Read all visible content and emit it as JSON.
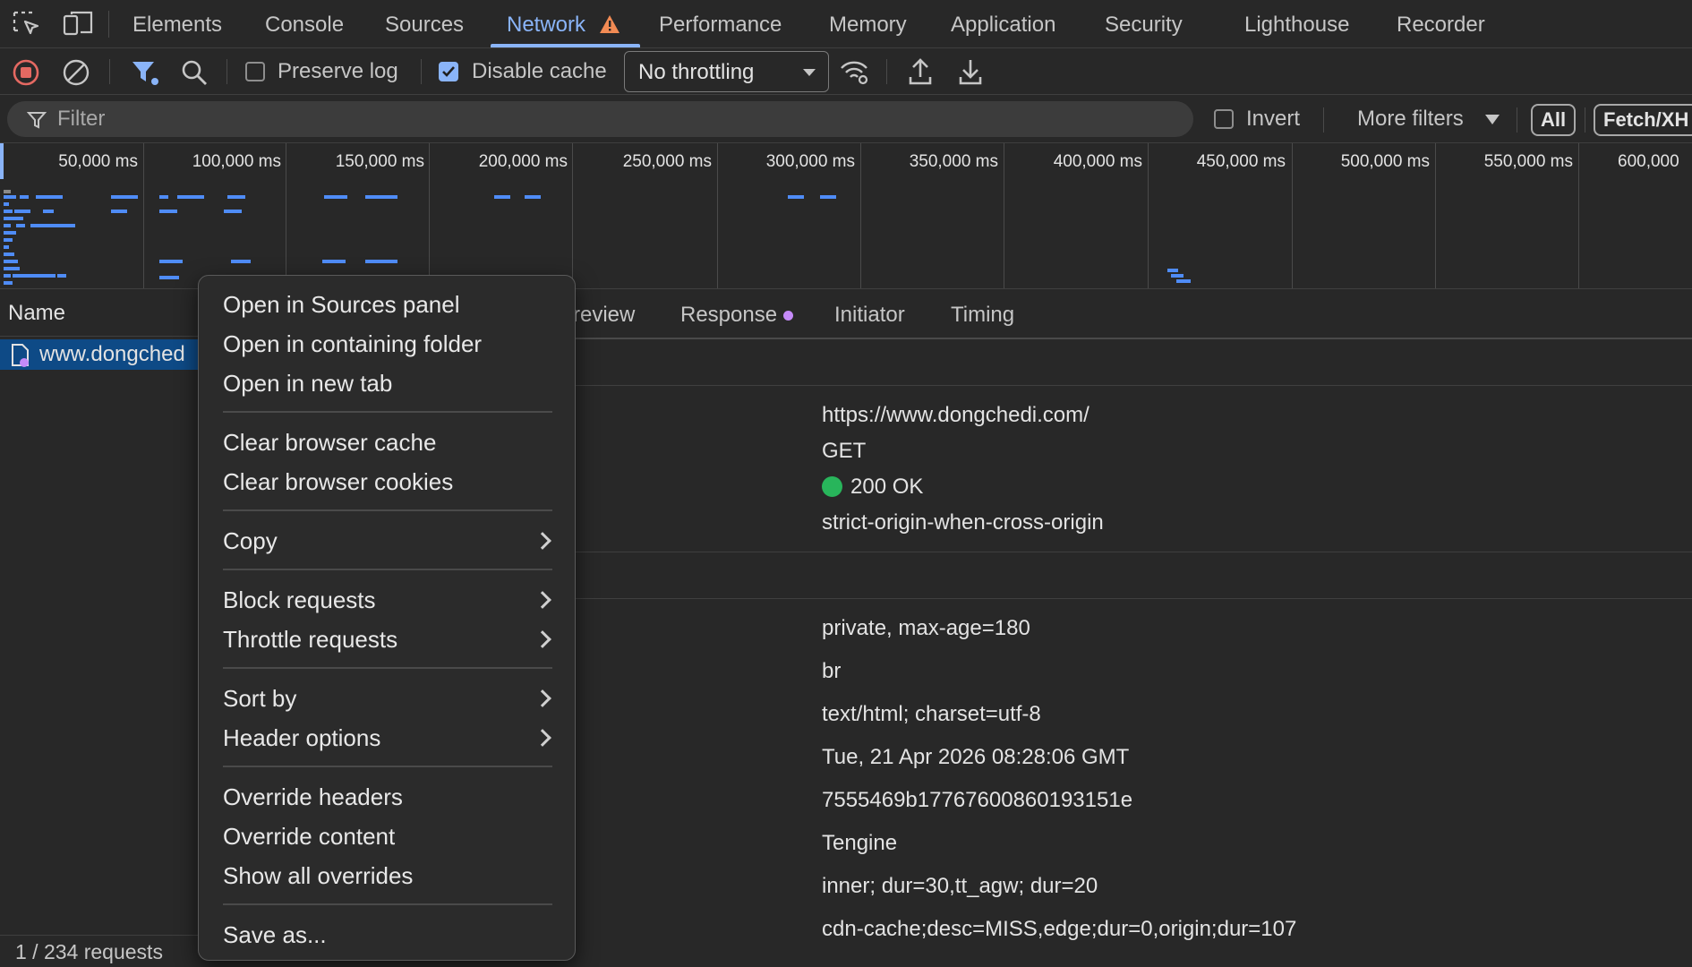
{
  "tabs": [
    {
      "label": "Elements"
    },
    {
      "label": "Console"
    },
    {
      "label": "Sources"
    },
    {
      "label": "Network"
    },
    {
      "label": "Performance"
    },
    {
      "label": "Memory"
    },
    {
      "label": "Application"
    },
    {
      "label": "Security"
    },
    {
      "label": "Lighthouse"
    },
    {
      "label": "Recorder"
    }
  ],
  "toolbar": {
    "preserve_log_label": "Preserve log",
    "preserve_log_checked": false,
    "disable_cache_label": "Disable cache",
    "disable_cache_checked": true,
    "throttling_value": "No throttling"
  },
  "filter": {
    "placeholder": "Filter",
    "invert_label": "Invert",
    "more_filters_label": "More filters",
    "type_buttons": [
      "All",
      "Fetch/XH"
    ]
  },
  "overview": {
    "ticks": [
      "50,000 ms",
      "100,000 ms",
      "150,000 ms",
      "200,000 ms",
      "250,000 ms",
      "300,000 ms",
      "350,000 ms",
      "400,000 ms",
      "450,000 ms",
      "500,000 ms",
      "550,000 ms",
      "600,000"
    ]
  },
  "request_list": {
    "column_name": "Name",
    "selected_request": "www.dongched",
    "status": "1 / 234 requests"
  },
  "details": {
    "tabs": [
      "review",
      "Response",
      "Initiator",
      "Timing"
    ],
    "general": {
      "url": "https://www.dongchedi.com/",
      "method": "GET",
      "status": "200 OK",
      "referrer_policy": "strict-origin-when-cross-origin"
    },
    "response_headers": [
      "private, max-age=180",
      "br",
      "text/html; charset=utf-8",
      "Tue, 21 Apr 2026 08:28:06 GMT",
      "7555469b17767600860193151e",
      "Tengine",
      "inner; dur=30,tt_agw; dur=20",
      "cdn-cache;desc=MISS,edge;dur=0,origin;dur=107"
    ]
  },
  "context_menu": {
    "items": [
      {
        "label": "Open in Sources panel"
      },
      {
        "label": "Open in containing folder"
      },
      {
        "label": "Open in new tab"
      },
      {
        "label": "Clear browser cache"
      },
      {
        "label": "Clear browser cookies"
      },
      {
        "label": "Copy"
      },
      {
        "label": "Block requests"
      },
      {
        "label": "Throttle requests"
      },
      {
        "label": "Sort by"
      },
      {
        "label": "Header options"
      },
      {
        "label": "Override headers"
      },
      {
        "label": "Override content"
      },
      {
        "label": "Show all overrides"
      },
      {
        "label": "Save as..."
      }
    ]
  },
  "colors": {
    "accent": "#8ab4f8",
    "warning": "#f28b54",
    "record_red": "#e46962",
    "status_green": "#28b55b",
    "selection": "#0e4a86"
  }
}
